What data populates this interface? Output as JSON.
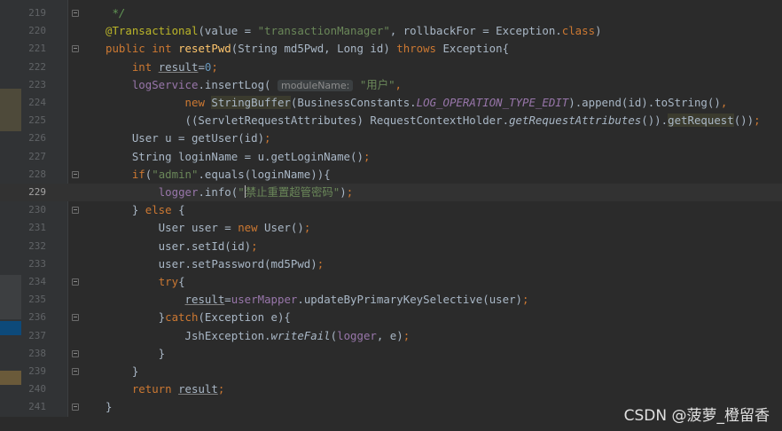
{
  "editor": {
    "lines": [
      {
        "no": "219",
        "parts": [
          {
            "t": " */",
            "c": "cmt"
          }
        ]
      },
      {
        "no": "220",
        "parts": [
          {
            "t": "@Transactional",
            "c": "ann"
          },
          {
            "t": "(value = ",
            "c": ""
          },
          {
            "t": "\"transactionManager\"",
            "c": "str"
          },
          {
            "t": ", rollbackFor = Exception.",
            "c": ""
          },
          {
            "t": "class",
            "c": "kw"
          },
          {
            "t": ")",
            "c": ""
          }
        ]
      },
      {
        "no": "221",
        "parts": [
          {
            "t": "public int ",
            "c": "kw"
          },
          {
            "t": "resetPwd",
            "c": "fn"
          },
          {
            "t": "(String md5Pwd, Long id) ",
            "c": ""
          },
          {
            "t": "throws ",
            "c": "kw"
          },
          {
            "t": "Exception{",
            "c": ""
          }
        ]
      },
      {
        "no": "222",
        "parts": [
          {
            "t": "    ",
            "c": ""
          },
          {
            "t": "int ",
            "c": "kw"
          },
          {
            "t": "result",
            "c": "ul"
          },
          {
            "t": "=",
            "c": ""
          },
          {
            "t": "0",
            "c": "num"
          },
          {
            "t": ";",
            "c": "kw"
          }
        ]
      },
      {
        "no": "223",
        "parts": [
          {
            "t": "    ",
            "c": ""
          },
          {
            "t": "logService",
            "c": "field"
          },
          {
            "t": ".insertLog( ",
            "c": ""
          },
          {
            "t": "moduleName:",
            "c": "hint"
          },
          {
            "t": " ",
            "c": ""
          },
          {
            "t": "\"用户\"",
            "c": "str"
          },
          {
            "t": ",",
            "c": "kw"
          }
        ]
      },
      {
        "no": "224",
        "parts": [
          {
            "t": "            ",
            "c": ""
          },
          {
            "t": "new ",
            "c": "kw"
          },
          {
            "t": "StringBuffer",
            "c": "hl"
          },
          {
            "t": "(BusinessConstants.",
            "c": ""
          },
          {
            "t": "LOG_OPERATION_TYPE_EDIT",
            "c": "const"
          },
          {
            "t": ").append(id).toString()",
            "c": ""
          },
          {
            "t": ",",
            "c": "kw"
          }
        ]
      },
      {
        "no": "225",
        "parts": [
          {
            "t": "            ((ServletRequestAttributes) RequestContextHolder.",
            "c": ""
          },
          {
            "t": "getRequestAttributes",
            "c": "it"
          },
          {
            "t": "()).",
            "c": ""
          },
          {
            "t": "getRequest",
            "c": "hl"
          },
          {
            "t": "())",
            "c": ""
          },
          {
            "t": ";",
            "c": "kw"
          }
        ]
      },
      {
        "no": "226",
        "parts": [
          {
            "t": "    User u = getUser(id)",
            "c": ""
          },
          {
            "t": ";",
            "c": "kw"
          }
        ]
      },
      {
        "no": "227",
        "parts": [
          {
            "t": "    String loginName = u.getLoginName()",
            "c": ""
          },
          {
            "t": ";",
            "c": "kw"
          }
        ]
      },
      {
        "no": "228",
        "parts": [
          {
            "t": "    ",
            "c": ""
          },
          {
            "t": "if",
            "c": "kw"
          },
          {
            "t": "(",
            "c": ""
          },
          {
            "t": "\"admin\"",
            "c": "str"
          },
          {
            "t": ".equals(loginName)){",
            "c": ""
          }
        ]
      },
      {
        "no": "229",
        "current": true,
        "parts": [
          {
            "t": "        ",
            "c": ""
          },
          {
            "t": "logger",
            "c": "field"
          },
          {
            "t": ".info(",
            "c": ""
          },
          {
            "t": "\"",
            "c": "str"
          },
          {
            "t": "|",
            "c": "caret"
          },
          {
            "t": "禁止重置超管密码\"",
            "c": "str"
          },
          {
            "t": ")",
            "c": ""
          },
          {
            "t": ";",
            "c": "kw"
          }
        ]
      },
      {
        "no": "230",
        "parts": [
          {
            "t": "    } ",
            "c": ""
          },
          {
            "t": "else ",
            "c": "kw"
          },
          {
            "t": "{",
            "c": ""
          }
        ]
      },
      {
        "no": "231",
        "parts": [
          {
            "t": "        User user = ",
            "c": ""
          },
          {
            "t": "new ",
            "c": "kw"
          },
          {
            "t": "User()",
            "c": ""
          },
          {
            "t": ";",
            "c": "kw"
          }
        ]
      },
      {
        "no": "232",
        "parts": [
          {
            "t": "        user.setId(id)",
            "c": ""
          },
          {
            "t": ";",
            "c": "kw"
          }
        ]
      },
      {
        "no": "233",
        "parts": [
          {
            "t": "        user.setPassword(md5Pwd)",
            "c": ""
          },
          {
            "t": ";",
            "c": "kw"
          }
        ]
      },
      {
        "no": "234",
        "parts": [
          {
            "t": "        ",
            "c": ""
          },
          {
            "t": "try",
            "c": "kw"
          },
          {
            "t": "{",
            "c": ""
          }
        ]
      },
      {
        "no": "235",
        "parts": [
          {
            "t": "            ",
            "c": ""
          },
          {
            "t": "result",
            "c": "ul"
          },
          {
            "t": "=",
            "c": ""
          },
          {
            "t": "userMapper",
            "c": "field"
          },
          {
            "t": ".updateByPrimaryKeySelective(user)",
            "c": ""
          },
          {
            "t": ";",
            "c": "kw"
          }
        ]
      },
      {
        "no": "236",
        "parts": [
          {
            "t": "        }",
            "c": ""
          },
          {
            "t": "catch",
            "c": "kw"
          },
          {
            "t": "(Exception e){",
            "c": ""
          }
        ]
      },
      {
        "no": "237",
        "parts": [
          {
            "t": "            JshException.",
            "c": ""
          },
          {
            "t": "writeFail",
            "c": "it"
          },
          {
            "t": "(",
            "c": ""
          },
          {
            "t": "logger",
            "c": "field"
          },
          {
            "t": ", e)",
            "c": ""
          },
          {
            "t": ";",
            "c": "kw"
          }
        ]
      },
      {
        "no": "238",
        "parts": [
          {
            "t": "        }",
            "c": ""
          }
        ]
      },
      {
        "no": "239",
        "parts": [
          {
            "t": "    }",
            "c": ""
          }
        ]
      },
      {
        "no": "240",
        "parts": [
          {
            "t": "    ",
            "c": ""
          },
          {
            "t": "return ",
            "c": "kw"
          },
          {
            "t": "result",
            "c": "ul"
          },
          {
            "t": ";",
            "c": "kw"
          }
        ]
      },
      {
        "no": "241",
        "parts": [
          {
            "t": "}",
            "c": ""
          }
        ]
      }
    ],
    "fold_markers": [
      "219",
      "221",
      "228",
      "230",
      "234",
      "236",
      "238",
      "239",
      "241"
    ],
    "left_marks": [
      {
        "color": "#4e4a3a"
      },
      {
        "color": "#3d3f41"
      },
      {
        "color": "#0d4a7a"
      },
      {
        "color": "#6a5a3a"
      }
    ]
  },
  "watermark": {
    "text": "CSDN @菠萝_橙留香"
  },
  "colors": {
    "background": "#2b2b2b",
    "gutter": "#313335",
    "keyword": "#cc7832",
    "string": "#6a8759",
    "number": "#6897bb",
    "annotation": "#bbb529",
    "method": "#ffc66d",
    "field": "#9876aa"
  }
}
